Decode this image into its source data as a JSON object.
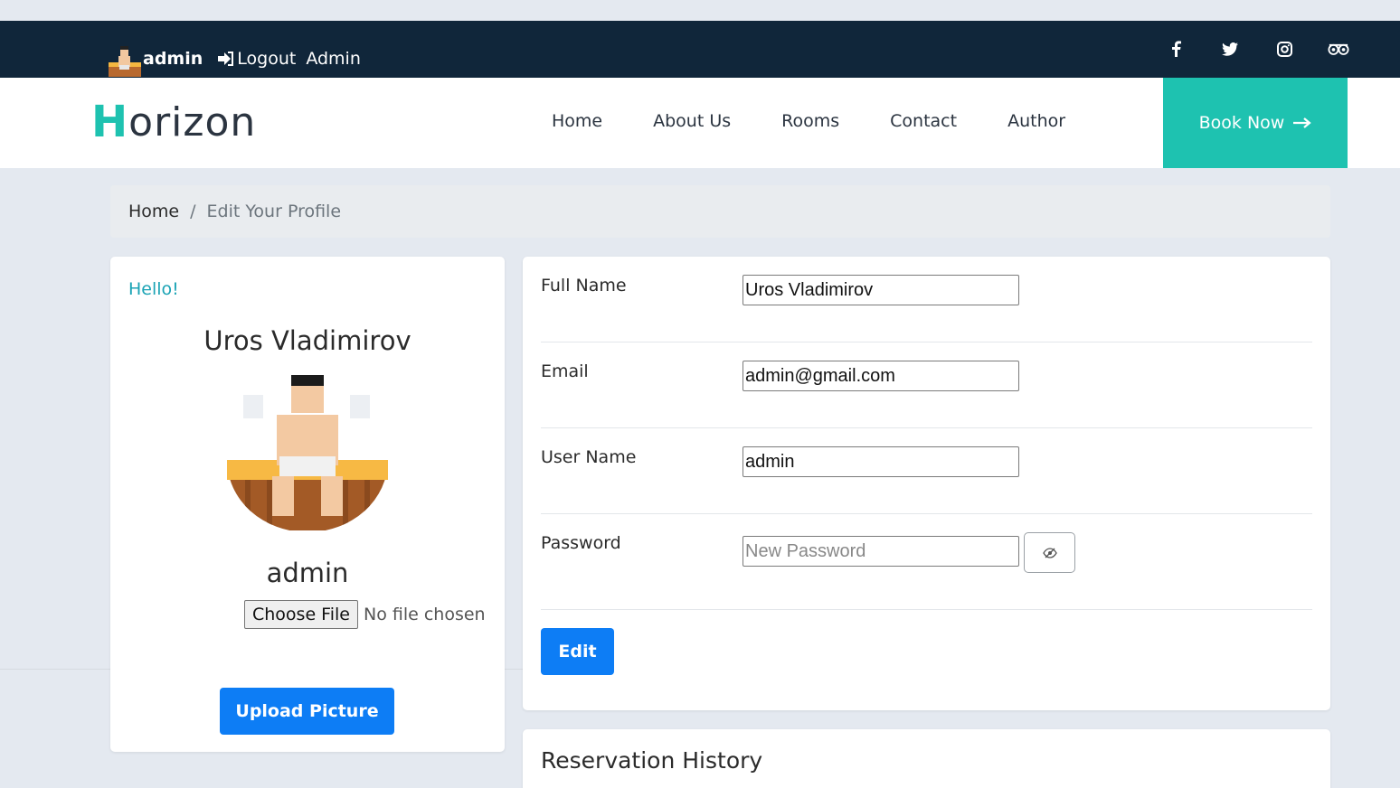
{
  "topbar": {
    "username": "admin",
    "logout_label": "Logout",
    "role": "Admin",
    "social_icons": [
      "facebook-icon",
      "twitter-icon",
      "instagram-icon",
      "tripadvisor-icon"
    ]
  },
  "navbar": {
    "logo_first": "H",
    "logo_rest": "orizon",
    "links": [
      "Home",
      "About Us",
      "Rooms",
      "Contact",
      "Author"
    ],
    "book_label": "Book Now"
  },
  "breadcrumb": {
    "home": "Home",
    "separator": "/",
    "current": "Edit Your Profile"
  },
  "profile": {
    "greeting": "Hello!",
    "full_name": "Uros Vladimirov",
    "username": "admin",
    "choose_file_label": "Choose File",
    "no_file_label": "No file chosen",
    "upload_label": "Upload Picture"
  },
  "form": {
    "full_name_label": "Full Name",
    "full_name_value": "Uros Vladimirov",
    "email_label": "Email",
    "email_value": "admin@gmail.com",
    "user_name_label": "User Name",
    "user_name_value": "admin",
    "password_label": "Password",
    "password_placeholder": "New Password",
    "edit_label": "Edit"
  },
  "history": {
    "title": "Reservation History"
  },
  "colors": {
    "topbar_bg": "#10263a",
    "accent": "#1ec2b0",
    "primary_button": "#0d7df5",
    "greeting": "#1aa3b5"
  }
}
